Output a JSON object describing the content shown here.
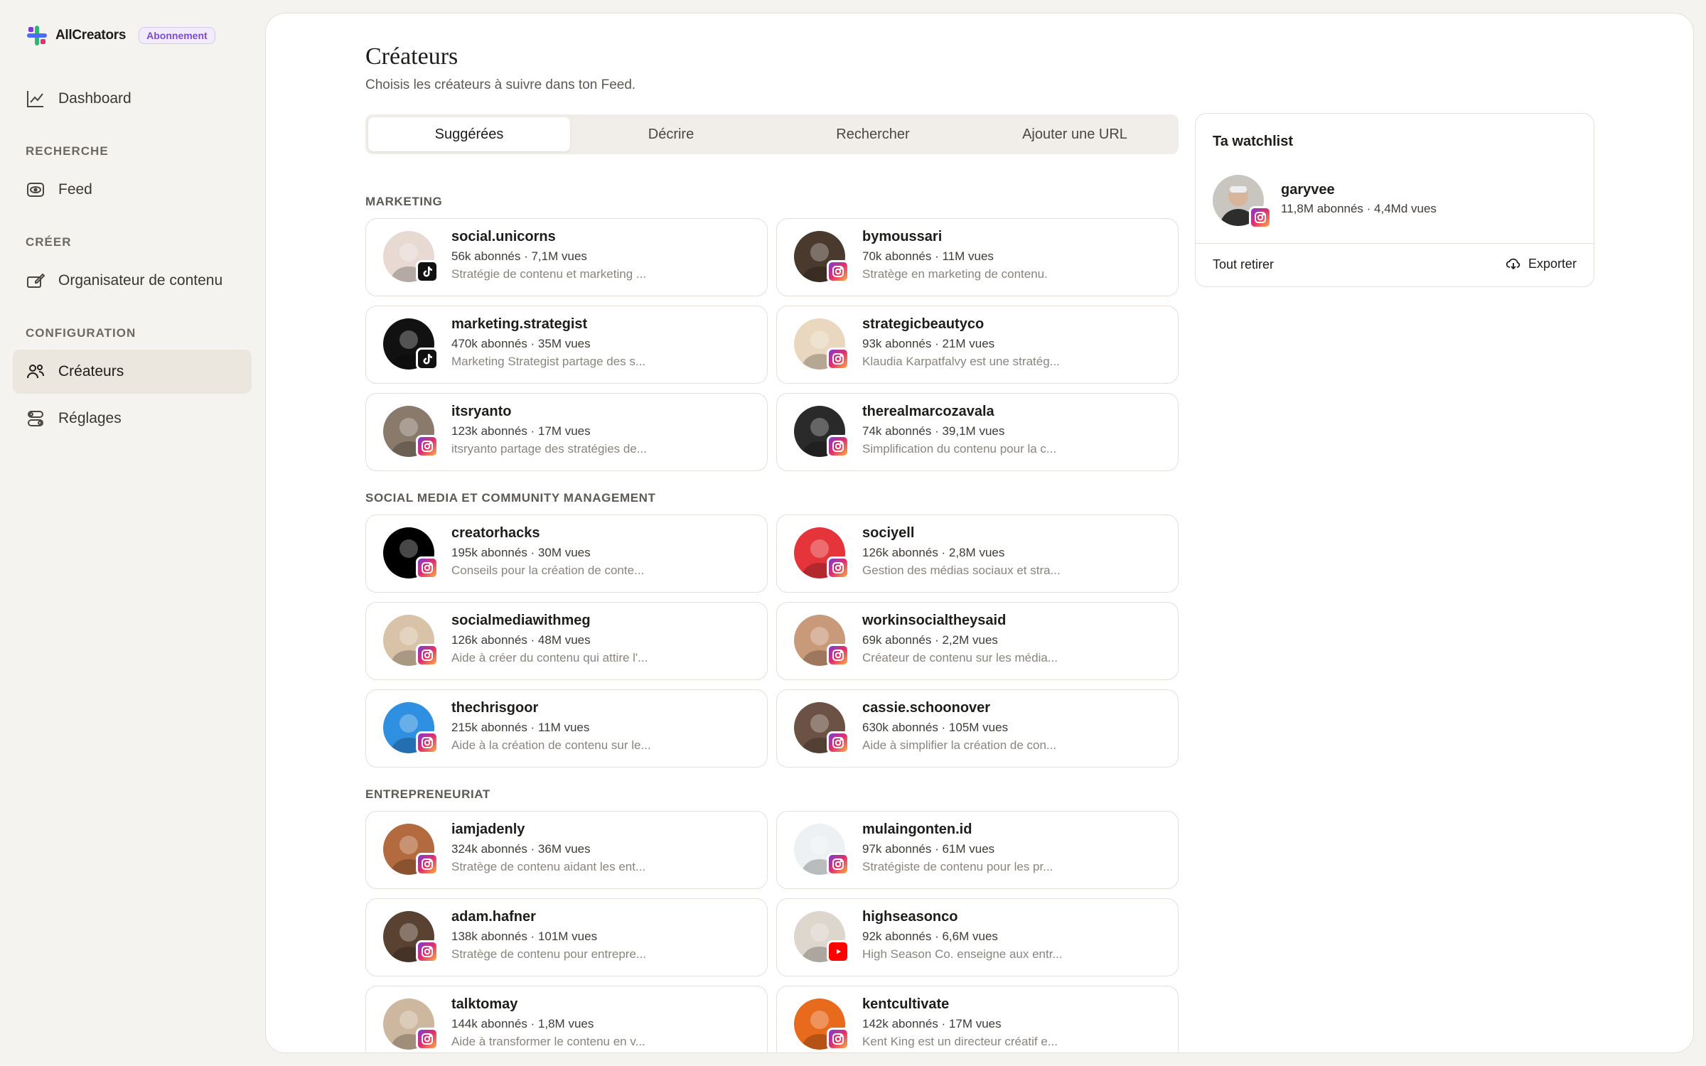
{
  "brand": {
    "name": "AllCreators",
    "badge": "Abonnement"
  },
  "nav": {
    "dashboard": "Dashboard",
    "section_recherche": "RECHERCHE",
    "feed": "Feed",
    "section_creer": "CRÉER",
    "organisateur": "Organisateur de contenu",
    "section_config": "CONFIGURATION",
    "createurs": "Créateurs",
    "reglages": "Réglages"
  },
  "page": {
    "title": "Créateurs",
    "subtitle": "Choisis les créateurs à suivre dans ton Feed."
  },
  "tabs": [
    "Suggérées",
    "Décrire",
    "Rechercher",
    "Ajouter une URL"
  ],
  "sections": [
    {
      "label": "MARKETING",
      "creators": [
        {
          "name": "social.unicorns",
          "stats": "56k abonnés · 7,1M vues",
          "desc": "Stratégie de contenu et marketing ...",
          "platform": "tiktok",
          "avatar_color": "#e8d9d2"
        },
        {
          "name": "bymoussari",
          "stats": "70k abonnés · 11M vues",
          "desc": "Stratège en marketing de contenu.",
          "platform": "instagram",
          "avatar_color": "#4a3a2e"
        },
        {
          "name": "marketing.strategist",
          "stats": "470k abonnés · 35M vues",
          "desc": "Marketing Strategist partage des s...",
          "platform": "tiktok",
          "avatar_color": "#111111"
        },
        {
          "name": "strategicbeautyco",
          "stats": "93k abonnés · 21M vues",
          "desc": "Klaudia Karpatfalvy est une stratég...",
          "platform": "instagram",
          "avatar_color": "#e9d7bf"
        },
        {
          "name": "itsryanto",
          "stats": "123k abonnés · 17M vues",
          "desc": "itsryanto partage des stratégies de...",
          "platform": "instagram",
          "avatar_color": "#8a7a6c"
        },
        {
          "name": "therealmarcozavala",
          "stats": "74k abonnés · 39,1M vues",
          "desc": "Simplification du contenu pour la c...",
          "platform": "instagram",
          "avatar_color": "#2a2a2a"
        }
      ]
    },
    {
      "label": "SOCIAL MEDIA ET COMMUNITY MANAGEMENT",
      "creators": [
        {
          "name": "creatorhacks",
          "stats": "195k abonnés · 30M vues",
          "desc": "Conseils pour la création de conte...",
          "platform": "instagram",
          "avatar_color": "#000000"
        },
        {
          "name": "sociyell",
          "stats": "126k abonnés · 2,8M vues",
          "desc": "Gestion des médias sociaux et stra...",
          "platform": "instagram",
          "avatar_color": "#e5343a"
        },
        {
          "name": "socialmediawithmeg",
          "stats": "126k abonnés · 48M vues",
          "desc": "Aide à créer du contenu qui attire l'...",
          "platform": "instagram",
          "avatar_color": "#d9c3a8"
        },
        {
          "name": "workinsocialtheysaid",
          "stats": "69k abonnés · 2,2M vues",
          "desc": "Créateur de contenu sur les média...",
          "platform": "instagram",
          "avatar_color": "#c99a7a"
        },
        {
          "name": "thechrisgoor",
          "stats": "215k abonnés · 11M vues",
          "desc": "Aide à la création de contenu sur le...",
          "platform": "instagram",
          "avatar_color": "#2f8fe0"
        },
        {
          "name": "cassie.schoonover",
          "stats": "630k abonnés · 105M vues",
          "desc": "Aide à simplifier la création de con...",
          "platform": "instagram",
          "avatar_color": "#6b5244"
        }
      ]
    },
    {
      "label": "ENTREPRENEURIAT",
      "creators": [
        {
          "name": "iamjadenly",
          "stats": "324k abonnés · 36M vues",
          "desc": "Stratège de contenu aidant les ent...",
          "platform": "instagram",
          "avatar_color": "#b36a3e"
        },
        {
          "name": "mulaingonten.id",
          "stats": "97k abonnés · 61M vues",
          "desc": "Stratégiste de contenu pour les pr...",
          "platform": "instagram",
          "avatar_color": "#eef1f3"
        },
        {
          "name": "adam.hafner",
          "stats": "138k abonnés · 101M vues",
          "desc": "Stratège de contenu pour entrepre...",
          "platform": "instagram",
          "avatar_color": "#5a4232"
        },
        {
          "name": "highseasonco",
          "stats": "92k abonnés · 6,6M vues",
          "desc": "High Season Co. enseigne aux entr...",
          "platform": "youtube",
          "avatar_color": "#dcd6cc"
        },
        {
          "name": "talktomay",
          "stats": "144k abonnés · 1,8M vues",
          "desc": "Aide à transformer le contenu en v...",
          "platform": "instagram",
          "avatar_color": "#cdb79e"
        },
        {
          "name": "kentcultivate",
          "stats": "142k abonnés · 17M vues",
          "desc": "Kent King est un directeur créatif e...",
          "platform": "instagram",
          "avatar_color": "#e86a1c"
        }
      ]
    }
  ],
  "watchlist": {
    "title": "Ta watchlist",
    "item": {
      "name": "garyvee",
      "stats": "11,8M abonnés · 4,4Md vues",
      "platform": "instagram"
    },
    "clear_label": "Tout retirer",
    "export_label": "Exporter"
  },
  "colors": {
    "accent": "#7c4dcc",
    "active_nav": "#ebe6de",
    "background": "#f5f3ef"
  }
}
